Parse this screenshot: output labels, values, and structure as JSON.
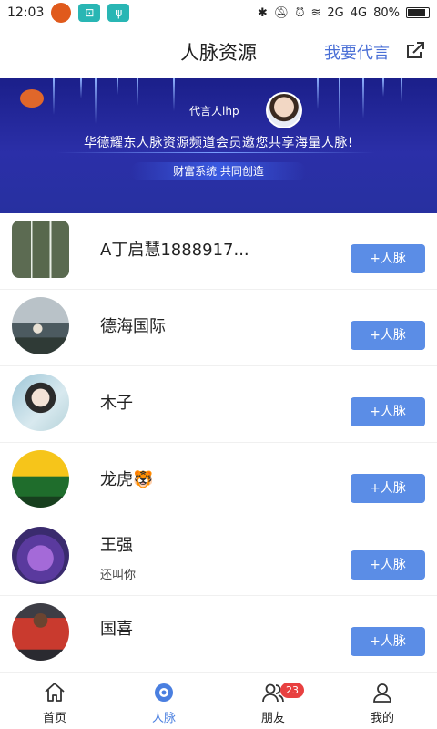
{
  "status_bar": {
    "time": "12:03",
    "network": "2G",
    "network2": "4G",
    "battery": "80%",
    "battery_level": 0.8
  },
  "header": {
    "title": "人脉资源",
    "action_label": "我要代言"
  },
  "banner": {
    "spokesperson": "代言人lhp",
    "headline": "华德耀东人脉资源频道会员邀您共享海量人脉!",
    "tagline": "财富系统 共同创造"
  },
  "contacts": [
    {
      "name": "A丁启慧1888917...",
      "subtitle": "",
      "button": "+人脉"
    },
    {
      "name": "德海国际",
      "subtitle": "",
      "button": "+人脉"
    },
    {
      "name": "木子",
      "subtitle": "",
      "button": "+人脉"
    },
    {
      "name": "龙虎🐯",
      "subtitle": "",
      "button": "+人脉"
    },
    {
      "name": "王强",
      "subtitle": "还叫你",
      "button": "+人脉"
    },
    {
      "name": "国喜",
      "subtitle": "",
      "button": "+人脉"
    }
  ],
  "tabs": [
    {
      "label": "首页",
      "icon": "home-icon",
      "active": false
    },
    {
      "label": "人脉",
      "icon": "network-icon",
      "active": true
    },
    {
      "label": "朋友",
      "icon": "friends-icon",
      "active": false,
      "badge": "23"
    },
    {
      "label": "我的",
      "icon": "profile-icon",
      "active": false
    }
  ],
  "colors": {
    "accent": "#5b8de6",
    "active_tab": "#4a7fe0",
    "badge": "#e84040",
    "banner": "#2b2fa8"
  }
}
